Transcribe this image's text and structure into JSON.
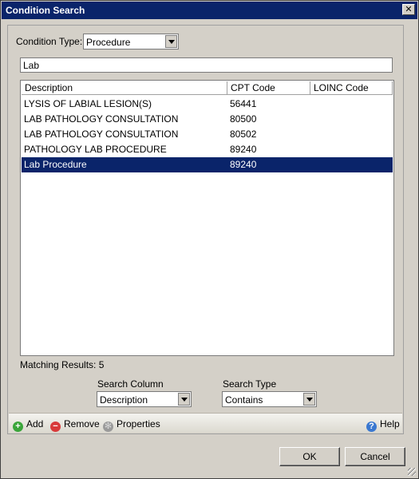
{
  "window": {
    "title": "Condition Search",
    "close_glyph": "✕"
  },
  "filter": {
    "condition_type_label": "Condition Type:",
    "condition_type_value": "Procedure",
    "search_text": "Lab"
  },
  "grid": {
    "columns": [
      "Description",
      "CPT Code",
      "LOINC Code"
    ],
    "rows": [
      {
        "description": "LYSIS OF LABIAL LESION(S)",
        "cpt": "56441",
        "loinc": ""
      },
      {
        "description": "LAB PATHOLOGY CONSULTATION",
        "cpt": "80500",
        "loinc": ""
      },
      {
        "description": "LAB PATHOLOGY CONSULTATION",
        "cpt": "80502",
        "loinc": ""
      },
      {
        "description": "PATHOLOGY LAB PROCEDURE",
        "cpt": "89240",
        "loinc": ""
      },
      {
        "description": "Lab Procedure",
        "cpt": "89240",
        "loinc": ""
      }
    ],
    "selected_row": 4,
    "selection_color": "#0a246a"
  },
  "results": {
    "label": "Matching Results: 5"
  },
  "search_options": {
    "column_label": "Search Column",
    "column_value": "Description",
    "type_label": "Search Type",
    "type_value": "Contains"
  },
  "toolbar": {
    "add_label": "Add",
    "remove_label": "Remove",
    "properties_label": "Properties",
    "help_label": "Help"
  },
  "buttons": {
    "ok_label": "OK",
    "cancel_label": "Cancel"
  }
}
